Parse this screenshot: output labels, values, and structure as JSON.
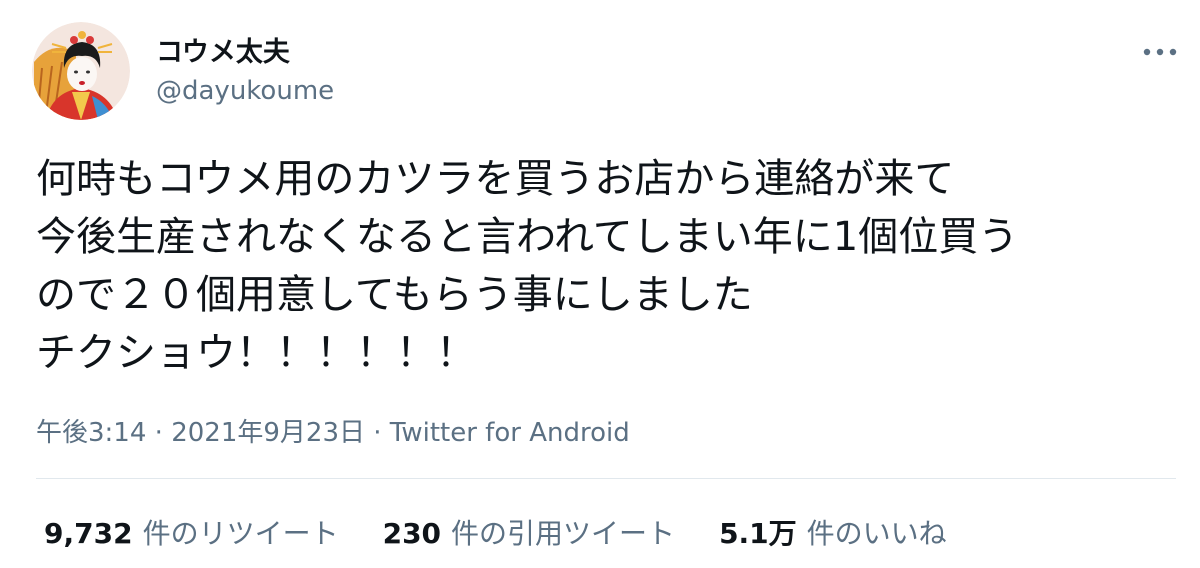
{
  "author": {
    "display_name": "コウメ太夫",
    "handle": "@dayukoume",
    "avatar_icon": "avatar-koume-dayu"
  },
  "more_icon": "more-horizontal-icon",
  "tweet": {
    "lines": [
      "何時もコウメ用のカツラを買うお店から連絡が来て",
      "今後生産されなくなると言われてしまい年に1個位買う",
      "ので２０個用意してもらう事にしました",
      "チクショウ！！！！！！"
    ]
  },
  "meta": {
    "time": "午後3:14",
    "separator": " · ",
    "date": "2021年9月23日",
    "client": "Twitter for Android"
  },
  "stats": {
    "retweets": {
      "count": "9,732",
      "label": "件のリツイート"
    },
    "quotes": {
      "count": "230",
      "label": "件の引用ツイート"
    },
    "likes": {
      "count": "5.1万",
      "label": "件のいいね"
    }
  },
  "colors": {
    "text_primary": "#0f1419",
    "text_secondary": "#5b7083",
    "divider": "#e1e8ed"
  }
}
